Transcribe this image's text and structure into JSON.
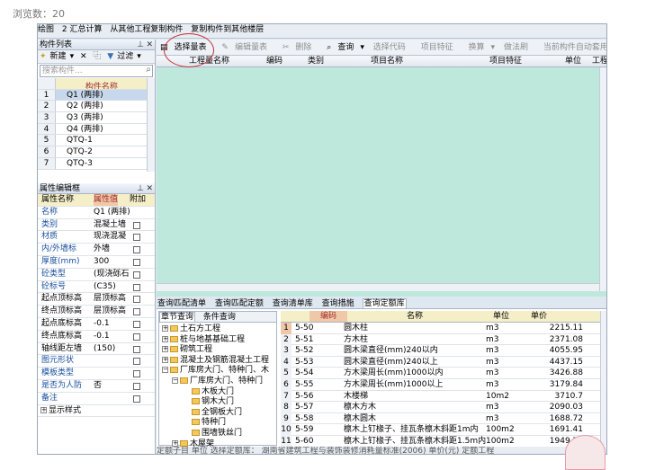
{
  "page": {
    "view_count": "浏览数：20"
  },
  "topbar": {
    "items": [
      "绘图",
      "2 汇总计算",
      "从其他工程复制构件",
      "复制构件到其他楼层"
    ]
  },
  "component_list": {
    "title": "构件列表",
    "toolbar": {
      "new": "新建",
      "delete": "✕",
      "copy": "⿻",
      "filter": "过滤"
    },
    "search_placeholder": "搜索构件...",
    "header": "构件名称",
    "rows": [
      {
        "n": "1",
        "name": "Q1 (两排)"
      },
      {
        "n": "2",
        "name": "Q2 (两排)"
      },
      {
        "n": "3",
        "name": "Q3 (两排)"
      },
      {
        "n": "4",
        "name": "Q4 (两排)"
      },
      {
        "n": "5",
        "name": "QTQ-1"
      },
      {
        "n": "6",
        "name": "QTQ-2"
      },
      {
        "n": "7",
        "name": "QTQ-3"
      }
    ]
  },
  "property_editor": {
    "title": "属性编辑框",
    "headers": {
      "name": "属性名称",
      "value": "属性值",
      "attach": "附加"
    },
    "rows": [
      {
        "name": "名称",
        "value": "Q1 (两排)",
        "blue": true,
        "cb": false
      },
      {
        "name": "类别",
        "value": "混凝土墙",
        "blue": true,
        "cb": true
      },
      {
        "name": "材质",
        "value": "现浇混凝",
        "blue": true,
        "cb": true
      },
      {
        "name": "内/外墙标",
        "value": "外墙",
        "blue": true,
        "cb": true
      },
      {
        "name": "厚度(mm)",
        "value": "300",
        "blue": true,
        "cb": true
      },
      {
        "name": "砼类型",
        "value": "(现浇砾石",
        "blue": true,
        "cb": true
      },
      {
        "name": "砼标号",
        "value": "(C35)",
        "blue": true,
        "cb": true
      },
      {
        "name": "起点顶标高",
        "value": "层顶标高",
        "blue": false,
        "cb": true
      },
      {
        "name": "终点顶标高",
        "value": "层顶标高",
        "blue": false,
        "cb": true
      },
      {
        "name": "起点底标高",
        "value": "-0.1",
        "blue": false,
        "cb": true
      },
      {
        "name": "终点底标高",
        "value": "-0.1",
        "blue": false,
        "cb": true
      },
      {
        "name": "轴线距左墙",
        "value": "(150)",
        "blue": false,
        "cb": true
      },
      {
        "name": "图元形状",
        "value": "",
        "blue": true,
        "cb": true
      },
      {
        "name": "模板类型",
        "value": "",
        "blue": true,
        "cb": true
      },
      {
        "name": "是否为人防",
        "value": "否",
        "blue": true,
        "cb": true
      },
      {
        "name": "备注",
        "value": "",
        "blue": true,
        "cb": true
      }
    ],
    "more": "显示样式"
  },
  "main_toolbar": {
    "select_list": "选择量表",
    "edit_list": "编辑量表",
    "delete": "删除",
    "query": "查询",
    "select_code": "选择代码",
    "item_feature": "项目特征",
    "convert": "换算",
    "method_lib": "做法刷",
    "current_auto": "当前构件自动套用做法"
  },
  "quantity_table": {
    "headers": [
      "工程量名称",
      "编码",
      "类别",
      "项目名称",
      "项目特征",
      "单位",
      "工程"
    ]
  },
  "query_panel": {
    "tabs": [
      "查询匹配清单",
      "查询匹配定额",
      "查询清单库",
      "查询措施",
      "查询定额库"
    ],
    "subtabs": [
      "章节查询",
      "条件查询"
    ],
    "tree": [
      {
        "label": "土石方工程",
        "indent": 0,
        "exp": "+"
      },
      {
        "label": "桩与地基基础工程",
        "indent": 0,
        "exp": "+"
      },
      {
        "label": "砌筑工程",
        "indent": 0,
        "exp": "+"
      },
      {
        "label": "混凝土及钢筋混凝土工程",
        "indent": 0,
        "exp": "+"
      },
      {
        "label": "厂库房大门、特种门、木",
        "indent": 0,
        "exp": "−"
      },
      {
        "label": "厂库房大门、特种门",
        "indent": 1,
        "exp": "−"
      },
      {
        "label": "木板大门",
        "indent": 2,
        "exp": ""
      },
      {
        "label": "钢木大门",
        "indent": 2,
        "exp": ""
      },
      {
        "label": "全钢板大门",
        "indent": 2,
        "exp": ""
      },
      {
        "label": "特种门",
        "indent": 2,
        "exp": ""
      },
      {
        "label": "围墙铁丝门",
        "indent": 2,
        "exp": ""
      },
      {
        "label": "木屋架",
        "indent": 1,
        "exp": "+"
      }
    ],
    "table_headers": [
      "编码",
      "名称",
      "单位",
      "单价"
    ],
    "rows": [
      {
        "n": "1",
        "code": "5-50",
        "name": "圆木柱",
        "unit": "m3",
        "price": "2215.11"
      },
      {
        "n": "2",
        "code": "5-51",
        "name": "方木柱",
        "unit": "m3",
        "price": "2371.08"
      },
      {
        "n": "3",
        "code": "5-52",
        "name": "圆木梁直径(mm)240以内",
        "unit": "m3",
        "price": "4055.95"
      },
      {
        "n": "4",
        "code": "5-53",
        "name": "圆木梁直径(mm)240以上",
        "unit": "m3",
        "price": "4437.15"
      },
      {
        "n": "5",
        "code": "5-54",
        "name": "方木梁周长(mm)1000以内",
        "unit": "m3",
        "price": "3426.88"
      },
      {
        "n": "6",
        "code": "5-55",
        "name": "方木梁周长(mm)1000以上",
        "unit": "m3",
        "price": "3179.84"
      },
      {
        "n": "7",
        "code": "5-56",
        "name": "木楼梯",
        "unit": "10m2",
        "price": "3710.7"
      },
      {
        "n": "8",
        "code": "5-57",
        "name": "檩木方木",
        "unit": "m3",
        "price": "2090.03"
      },
      {
        "n": "9",
        "code": "5-58",
        "name": "檩木圆木",
        "unit": "m3",
        "price": "1688.72"
      },
      {
        "n": "10",
        "code": "5-59",
        "name": "檩木上钉椽子、挂瓦条檩木斜距1m内",
        "unit": "100m2",
        "price": "1691.41"
      },
      {
        "n": "11",
        "code": "5-60",
        "name": "檩木上钉椽子、挂瓦条檩木斜距1.5m内",
        "unit": "100m2",
        "price": "1949.78"
      }
    ]
  },
  "status_bar": {
    "text": "定额子目    单位    选择定额库：    湖南省建筑工程与装饰装修消耗量标准(2006)    单价(元)    定额工程"
  }
}
